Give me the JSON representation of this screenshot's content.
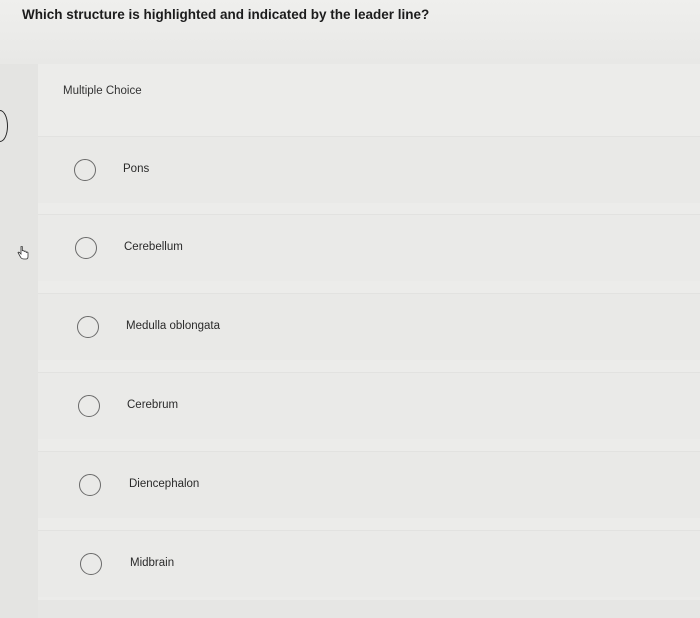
{
  "question": {
    "text": "Which structure is highlighted and indicated by the leader line?"
  },
  "card": {
    "heading": "Multiple Choice"
  },
  "options": [
    {
      "label": "Pons"
    },
    {
      "label": "Cerebellum"
    },
    {
      "label": "Medulla oblongata"
    },
    {
      "label": "Cerebrum"
    },
    {
      "label": "Diencephalon"
    },
    {
      "label": "Midbrain"
    }
  ],
  "icons": {
    "cursor": "hand-pointer-icon",
    "radio": "radio-button-empty"
  }
}
